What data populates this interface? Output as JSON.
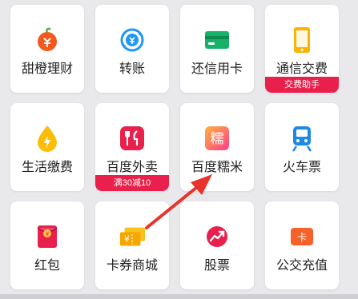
{
  "grid": {
    "items": [
      {
        "label": "甜橙理财",
        "icon": "orange-money-icon",
        "badge": ""
      },
      {
        "label": "转账",
        "icon": "transfer-icon",
        "badge": ""
      },
      {
        "label": "还信用卡",
        "icon": "credit-card-icon",
        "badge": ""
      },
      {
        "label": "通信交费",
        "icon": "phone-icon",
        "badge": "交费助手"
      },
      {
        "label": "生活缴费",
        "icon": "utility-drop-icon",
        "badge": ""
      },
      {
        "label": "百度外卖",
        "icon": "fork-knife-icon",
        "badge": "满30减10"
      },
      {
        "label": "百度糯米",
        "icon": "nuomi-icon",
        "badge": ""
      },
      {
        "label": "火车票",
        "icon": "train-icon",
        "badge": ""
      },
      {
        "label": "红包",
        "icon": "red-envelope-icon",
        "badge": ""
      },
      {
        "label": "卡券商城",
        "icon": "coupon-icon",
        "badge": ""
      },
      {
        "label": "股票",
        "icon": "stock-icon",
        "badge": ""
      },
      {
        "label": "公交充值",
        "icon": "bus-card-icon",
        "badge": ""
      }
    ]
  },
  "nuomi_glyph": "糯",
  "colors": {
    "badge": "#e8204b",
    "arrow": "#e8332d",
    "card": "#ffffff",
    "background": "#e9e9ec"
  }
}
